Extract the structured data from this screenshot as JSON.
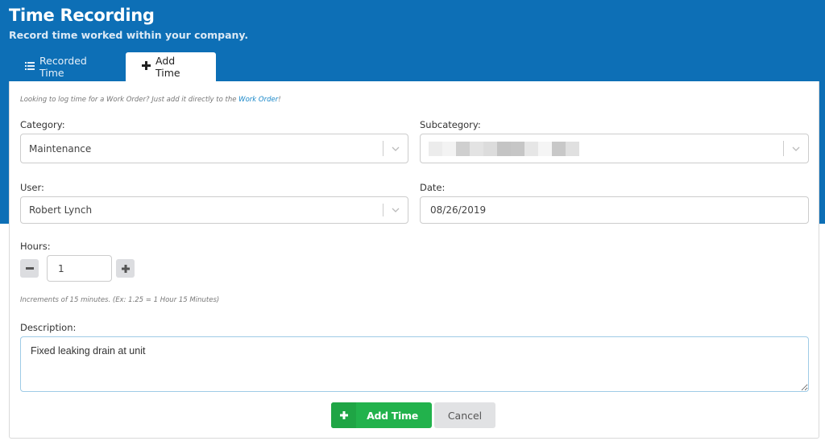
{
  "header": {
    "title": "Time Recording",
    "subtitle": "Record time worked within your company."
  },
  "tabs": [
    {
      "label": "Recorded Time",
      "icon": "list-icon",
      "active": false
    },
    {
      "label": "Add Time",
      "icon": "plus-icon",
      "active": true
    }
  ],
  "form": {
    "hint_prefix": "Looking to log time for a Work Order? Just add it directly to the ",
    "hint_link": "Work Order",
    "hint_suffix": "!",
    "category": {
      "label": "Category:",
      "value": "Maintenance"
    },
    "subcategory": {
      "label": "Subcategory:",
      "value": "[redacted]"
    },
    "user": {
      "label": "User:",
      "value": "Robert Lynch"
    },
    "date": {
      "label": "Date:",
      "value": "08/26/2019"
    },
    "hours": {
      "label": "Hours:",
      "value": "1",
      "decrement_symbol": "−",
      "increment_symbol": "+",
      "note": "Increments of 15 minutes. (Ex: 1.25 = 1 Hour 15 Minutes)"
    },
    "description": {
      "label": "Description:",
      "value": "Fixed leaking drain at unit"
    }
  },
  "actions": {
    "add_icon": "+",
    "add_label": "Add Time",
    "cancel_label": "Cancel"
  },
  "colors": {
    "header_blue": "#0d6fb6",
    "link_blue": "#1a88c9",
    "success_green": "#22b24c",
    "cancel_gray": "#e1e2e4"
  }
}
